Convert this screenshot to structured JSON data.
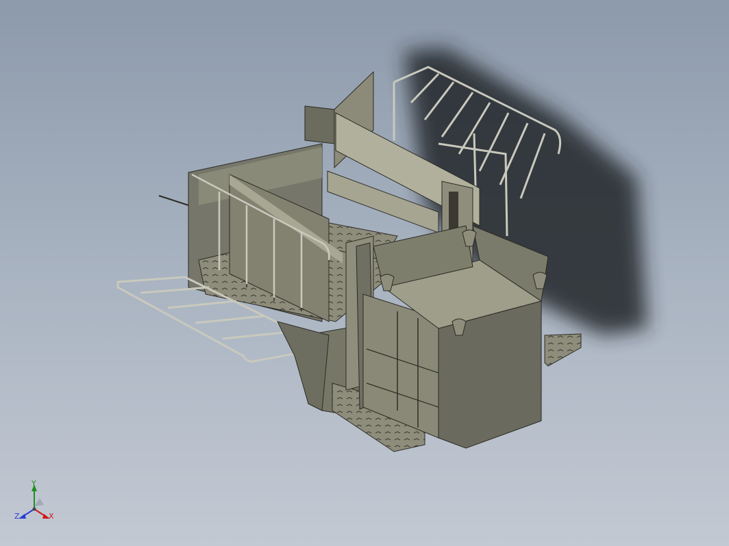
{
  "viewport": {
    "background_top": "#8d9aab",
    "background_bottom": "#c3c9d3"
  },
  "model": {
    "body_color": "#7f7f6e",
    "panel_light": "#a9a895",
    "panel_dark": "#5e5e52",
    "rail_color": "#c9c9bd",
    "shadow_color": "#23262b"
  },
  "triad": {
    "x_label": "X",
    "y_label": "Y",
    "z_label": "Z",
    "x_color": "#d01818",
    "y_color": "#1f8f1f",
    "z_color": "#2a3fd0"
  }
}
